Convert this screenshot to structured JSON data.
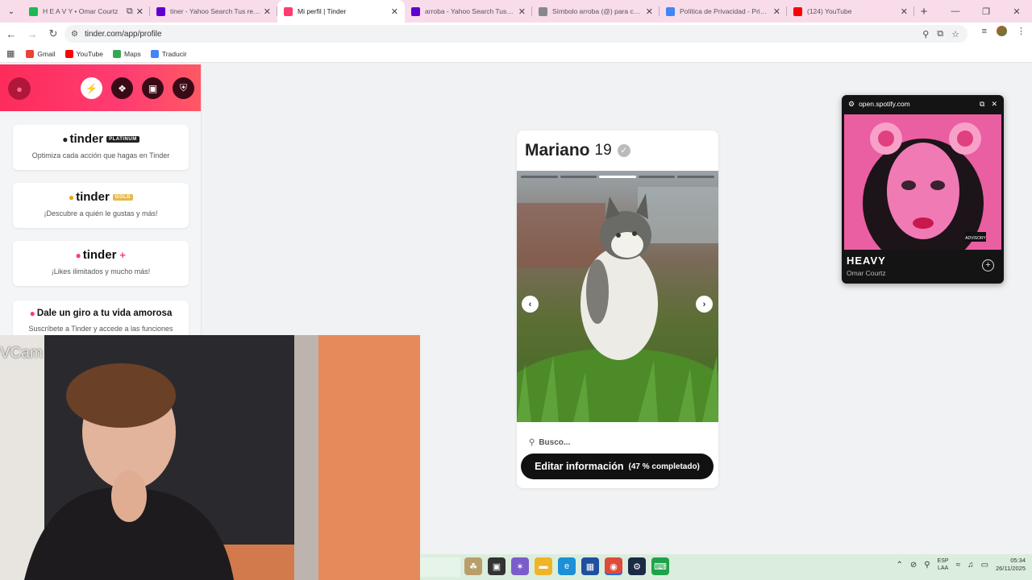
{
  "browser": {
    "tabs": [
      {
        "label": "H E A V Y • Omar Courtz",
        "favicon": "spotify-icon",
        "color": "#1db954",
        "extra": "picture-in-picture-icon"
      },
      {
        "label": "tiner - Yahoo Search Tus resultados",
        "favicon": "yahoo-icon",
        "color": "#6001d2"
      },
      {
        "label": "Mi perfil | Tinder",
        "favicon": "tinder-icon",
        "color": "#fe3c72",
        "active": true
      },
      {
        "label": "arroba - Yahoo Search Tus resultados",
        "favicon": "yahoo-icon",
        "color": "#6001d2"
      },
      {
        "label": "Símbolo arroba (@) para copiar",
        "favicon": "globe-icon",
        "color": "#888888"
      },
      {
        "label": "Política de Privacidad - Privacidad",
        "favicon": "google-icon",
        "color": "#4285f4"
      },
      {
        "label": "(124) YouTube",
        "favicon": "youtube-icon",
        "color": "#ff0000"
      }
    ],
    "url": "tinder.com/app/profile",
    "bookmarks": [
      {
        "label": "Gmail",
        "icon": "gmail-icon",
        "color": "#ea4335"
      },
      {
        "label": "YouTube",
        "icon": "youtube-icon",
        "color": "#ff0000"
      },
      {
        "label": "Maps",
        "icon": "maps-icon",
        "color": "#34a853"
      },
      {
        "label": "Traducir",
        "icon": "translate-icon",
        "color": "#4285f4"
      }
    ]
  },
  "sidebar": {
    "promos": [
      {
        "logo": "tinder",
        "badge": "PLATINUM",
        "badge_color": "#222222",
        "flame_color": "#222222",
        "subtitle": "Optimiza cada acción que hagas en Tinder"
      },
      {
        "logo": "tinder",
        "badge": "GOLD",
        "badge_color": "#e6b84c",
        "flame_color": "#e6a521",
        "subtitle": "¡Descubre a quién le gustas y más!"
      },
      {
        "logo": "tinder",
        "badge": "+",
        "badge_color": "#fe3c72",
        "flame_color": "#fe3c72",
        "subtitle": "¡Likes ilimitados y mucho más!"
      },
      {
        "logo": "Dale un giro a tu vida amorosa",
        "flame_color": "#fe3c72",
        "subtitle": "Suscríbete a Tinder y accede a las funciones"
      }
    ]
  },
  "profile": {
    "name": "Mariano",
    "age": "19",
    "photo_count": 5,
    "photo_index": 3,
    "search_text": "Busco...",
    "edit_label": "Editar información",
    "edit_progress": "(47 % completado)"
  },
  "spotify": {
    "url": "open.spotify.com",
    "title": "HEAVY",
    "artist": "Omar Courtz"
  },
  "webcam": {
    "label": "VCam"
  },
  "taskbar": {
    "lang_top": "ESP",
    "lang_bottom": "LAA",
    "time": "05:34",
    "date": "26/11/2025"
  }
}
